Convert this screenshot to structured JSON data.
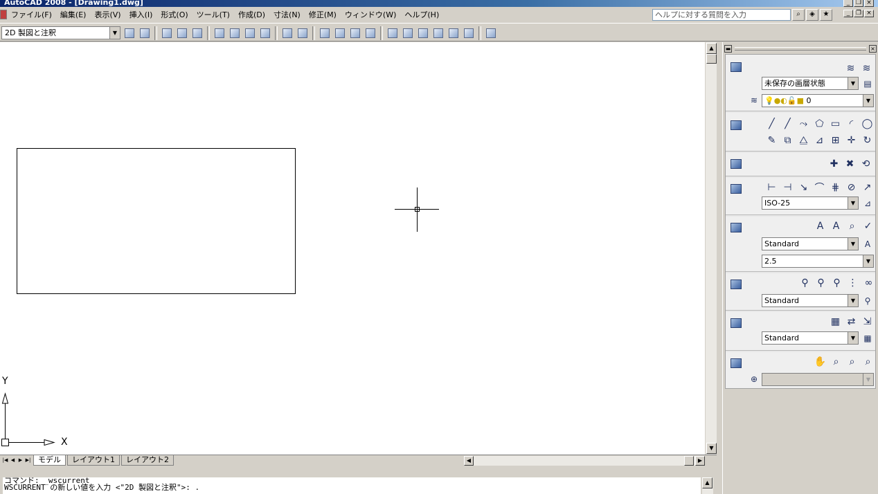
{
  "window": {
    "title": "AutoCAD 2008 - [Drawing1.dwg]"
  },
  "menubar": {
    "items": [
      "ファイル(F)",
      "編集(E)",
      "表示(V)",
      "挿入(I)",
      "形式(O)",
      "ツール(T)",
      "作成(D)",
      "寸法(N)",
      "修正(M)",
      "ウィンドウ(W)",
      "ヘルプ(H)"
    ],
    "help_search_placeholder": "ヘルプに対する質問を入力"
  },
  "toolbar": {
    "workspace_value": "2D 製図と注釈"
  },
  "canvas": {
    "ucs_x_label": "X",
    "ucs_y_label": "Y"
  },
  "layout_tabs": [
    "モデル",
    "レイアウト1",
    "レイアウト2"
  ],
  "command_window": {
    "lines": [
      "コマンド: _wscurrent",
      "WSCURRENT の新しい値を入力 <\"2D 製図と注釈\">: ."
    ]
  },
  "dashboard": {
    "layer_state_value": "未保存の画層状態",
    "layer_value": "0",
    "dim_style_value": "ISO-25",
    "text_style_value": "Standard",
    "text_height_value": "2.5",
    "mleader_style_value": "Standard",
    "table_style_value": "Standard",
    "nav_value": ""
  },
  "colors": {
    "title_bar": "#0a246a",
    "chrome": "#d4d0c8",
    "canvas": "#ffffff"
  }
}
